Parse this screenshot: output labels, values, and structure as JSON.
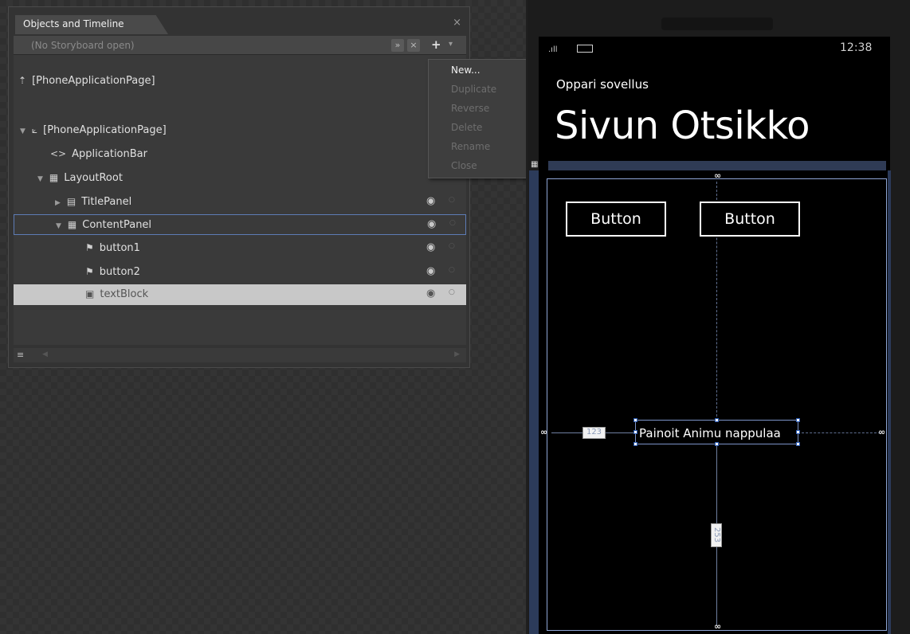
{
  "panel": {
    "title": "Objects and Timeline",
    "close": "×",
    "storyboard": {
      "text": "(No Storyboard open)",
      "btn1": "»",
      "btn2": "×",
      "add": "+",
      "caret": "▾"
    },
    "scene_root": "[PhoneApplicationPage]",
    "tree": [
      {
        "label": "[PhoneApplicationPage]",
        "icon": "page-icon",
        "glyph": "⟀",
        "arrow": "▼",
        "indent": 0
      },
      {
        "label": "ApplicationBar",
        "icon": "code-brackets-icon",
        "glyph": "<>",
        "arrow": "",
        "indent": 1
      },
      {
        "label": "LayoutRoot",
        "icon": "grid-icon",
        "glyph": "▦",
        "arrow": "▼",
        "indent": 1
      },
      {
        "label": "TitlePanel",
        "icon": "stack-panel-icon",
        "glyph": "▤",
        "arrow": "▶",
        "indent": 2,
        "eye": true
      },
      {
        "label": "ContentPanel",
        "icon": "grid-icon",
        "glyph": "▦",
        "arrow": "▼",
        "indent": 2,
        "eye": true
      },
      {
        "label": "button1",
        "icon": "button-icon",
        "glyph": "⚑",
        "arrow": "",
        "indent": 3,
        "eye": true
      },
      {
        "label": "button2",
        "icon": "button-icon",
        "glyph": "⚑",
        "arrow": "",
        "indent": 3,
        "eye": true
      },
      {
        "label": "textBlock",
        "icon": "textblock-icon",
        "glyph": "▣",
        "arrow": "",
        "indent": 3,
        "eye": true
      }
    ],
    "eye_glyph": "◉",
    "lock_glyph": "○",
    "scroll": {
      "icon": "≡",
      "left": "◀",
      "right": "▶"
    }
  },
  "menu": {
    "items": [
      {
        "label": "New...",
        "enabled": true
      },
      {
        "label": "Duplicate",
        "enabled": false
      },
      {
        "label": "Reverse",
        "enabled": false
      },
      {
        "label": "Delete",
        "enabled": false
      },
      {
        "label": "Rename",
        "enabled": false
      },
      {
        "label": "Close",
        "enabled": false
      }
    ]
  },
  "phone": {
    "signal": ".ıll",
    "time": "12:38",
    "app_title": "Oppari sovellus",
    "page_title": "Sivun Otsikko",
    "grid_marker": "▦",
    "button1": "Button",
    "button2": "Button",
    "textblock": "Painoit Animu nappulaa",
    "margin_left": "123",
    "margin_bottom": "253",
    "pin": "∞"
  },
  "colors": {
    "accent": "#5d7cb5",
    "panel_bg": "#333333",
    "selected_row": "#c8c8c8"
  }
}
